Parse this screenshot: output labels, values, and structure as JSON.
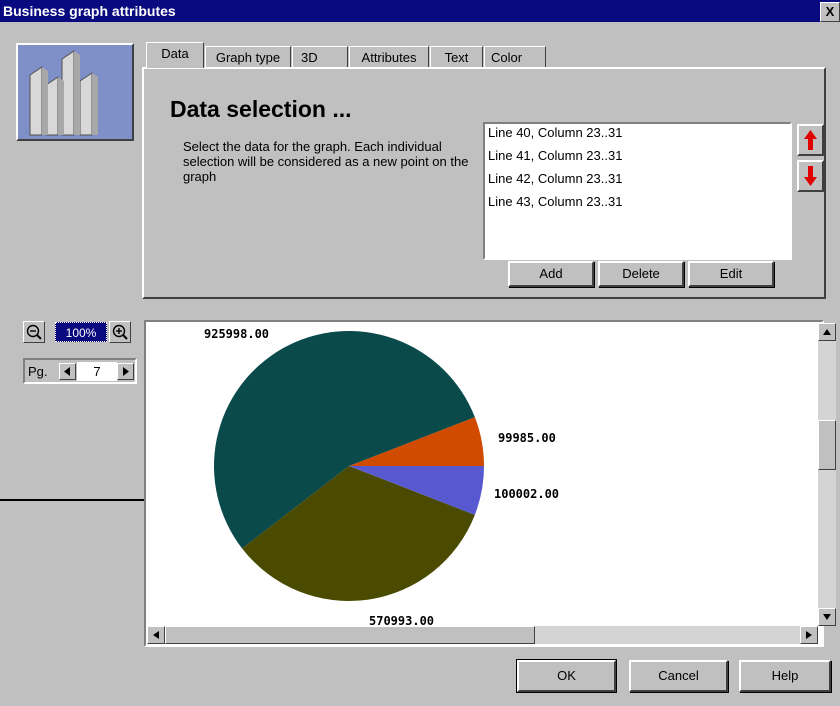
{
  "window": {
    "title": "Business graph attributes",
    "close_glyph": "X"
  },
  "tabs": [
    {
      "label": "Data",
      "active": true
    },
    {
      "label": "Graph type",
      "active": false
    },
    {
      "label": "3D",
      "active": false
    },
    {
      "label": "Attributes",
      "active": false
    },
    {
      "label": "Text",
      "active": false
    },
    {
      "label": "Color",
      "active": false
    }
  ],
  "data_panel": {
    "heading": "Data selection ...",
    "description": "Select the data for the graph. Each individual selection will be considered as a new point on the graph",
    "selections": [
      "Line 40, Column 23..31",
      "Line 41, Column 23..31",
      "Line 42, Column 23..31",
      "Line 43, Column 23..31"
    ],
    "add_label": "Add",
    "delete_label": "Delete",
    "edit_label": "Edit"
  },
  "preview": {
    "zoom_label": "100%",
    "page_label": "Pg.",
    "page_number": "7"
  },
  "chart_data": {
    "type": "pie",
    "title": "",
    "slices": [
      {
        "label": "925998.00",
        "value": 925998.0,
        "color": "#0a4a4a"
      },
      {
        "label": "99985.00",
        "value": 99985.0,
        "color": "#d04a00"
      },
      {
        "label": "100002.00",
        "value": 100002.0,
        "color": "#5858d0"
      },
      {
        "label": "570993.00",
        "value": 570993.0,
        "color": "#4a4a00"
      }
    ]
  },
  "footer": {
    "ok_label": "OK",
    "cancel_label": "Cancel",
    "help_label": "Help"
  },
  "colors": {
    "titlebar": "#0a0a80",
    "face": "#c0c0c0",
    "accent_arrow": "#e00000"
  }
}
